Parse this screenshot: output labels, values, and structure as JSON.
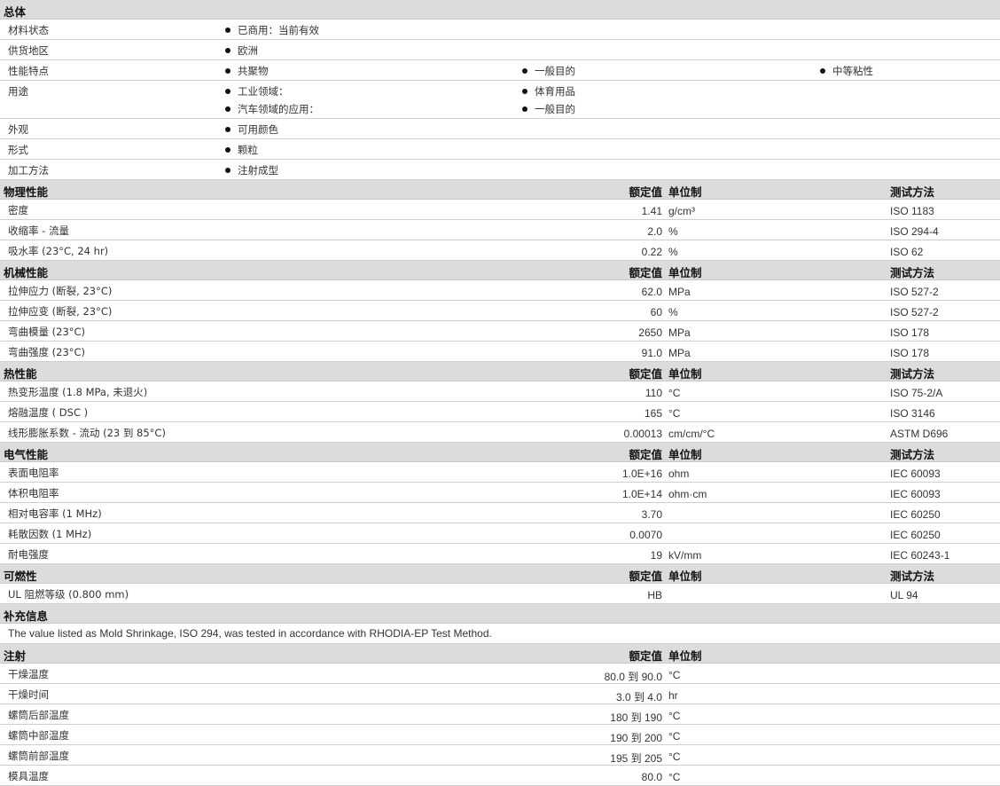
{
  "sections": {
    "general": {
      "title": "总体",
      "rows": [
        {
          "label": "材料状态",
          "items": [
            "已商用：当前有效"
          ]
        },
        {
          "label": "供货地区",
          "items": [
            "欧洲"
          ]
        },
        {
          "label": "性能特点",
          "items": [
            "共聚物",
            "一般目的",
            "中等粘性"
          ]
        },
        {
          "label": "用途",
          "items": [
            "工业领域：",
            "体育用品",
            "汽车领域的应用：",
            "一般目的"
          ]
        },
        {
          "label": "外观",
          "items": [
            "可用颜色"
          ]
        },
        {
          "label": "形式",
          "items": [
            "颗粒"
          ]
        },
        {
          "label": "加工方法",
          "items": [
            "注射成型"
          ]
        }
      ]
    },
    "col_heads": {
      "nominal": "额定值",
      "unit": "单位制",
      "test": "测试方法"
    },
    "physical": {
      "title": "物理性能",
      "rows": [
        {
          "label": "密度",
          "nominal": "1.41",
          "unit": "g/cm³",
          "test": "ISO 1183"
        },
        {
          "label": "收缩率 - 流量",
          "nominal": "2.0",
          "unit": "%",
          "test": "ISO 294-4"
        },
        {
          "label": "吸水率 (23°C, 24 hr)",
          "nominal": "0.22",
          "unit": "%",
          "test": "ISO 62"
        }
      ]
    },
    "mechanical": {
      "title": "机械性能",
      "rows": [
        {
          "label": "拉伸应力 (断裂, 23°C)",
          "nominal": "62.0",
          "unit": "MPa",
          "test": "ISO 527-2"
        },
        {
          "label": "拉伸应变 (断裂, 23°C)",
          "nominal": "60",
          "unit": "%",
          "test": "ISO 527-2"
        },
        {
          "label": "弯曲模量 (23°C)",
          "nominal": "2650",
          "unit": "MPa",
          "test": "ISO 178"
        },
        {
          "label": "弯曲强度 (23°C)",
          "nominal": "91.0",
          "unit": "MPa",
          "test": "ISO 178"
        }
      ]
    },
    "thermal": {
      "title": "热性能",
      "rows": [
        {
          "label": "热变形温度 (1.8 MPa, 未退火)",
          "nominal": "110",
          "unit": "°C",
          "test": "ISO 75-2/A"
        },
        {
          "label": "熔融温度 ( DSC )",
          "nominal": "165",
          "unit": "°C",
          "test": "ISO 3146"
        },
        {
          "label": "线形膨胀系数 - 流动 (23 到 85°C)",
          "nominal": "0.00013",
          "unit": "cm/cm/°C",
          "test": "ASTM D696"
        }
      ]
    },
    "electrical": {
      "title": "电气性能",
      "rows": [
        {
          "label": "表面电阻率",
          "nominal": "1.0E+16",
          "unit": "ohm",
          "test": "IEC 60093"
        },
        {
          "label": "体积电阻率",
          "nominal": "1.0E+14",
          "unit": "ohm·cm",
          "test": "IEC 60093"
        },
        {
          "label": "相对电容率 (1 MHz)",
          "nominal": "3.70",
          "unit": "",
          "test": "IEC 60250"
        },
        {
          "label": "耗散因数 (1 MHz)",
          "nominal": "0.0070",
          "unit": "",
          "test": "IEC 60250"
        },
        {
          "label": "耐电强度",
          "nominal": "19",
          "unit": "kV/mm",
          "test": "IEC 60243-1"
        }
      ]
    },
    "flammability": {
      "title": "可燃性",
      "rows": [
        {
          "label": "UL 阻燃等级 (0.800 mm)",
          "nominal": "HB",
          "unit": "",
          "test": "UL 94"
        }
      ]
    },
    "supplement": {
      "title": "补充信息",
      "note": "The value listed as Mold Shrinkage, ISO 294, was tested in accordance with RHODIA-EP Test Method."
    },
    "injection": {
      "title": "注射",
      "rows": [
        {
          "label": "干燥温度",
          "nominal": "80.0 到  90.0",
          "unit": "°C"
        },
        {
          "label": "干燥时间",
          "nominal": "3.0 到  4.0",
          "unit": "hr"
        },
        {
          "label": "螺筒后部温度",
          "nominal": "180 到  190",
          "unit": "°C"
        },
        {
          "label": "螺筒中部温度",
          "nominal": "190 到  200",
          "unit": "°C"
        },
        {
          "label": "螺筒前部温度",
          "nominal": "195 到  205",
          "unit": "°C"
        },
        {
          "label": "模具温度",
          "nominal": "80.0",
          "unit": "°C"
        }
      ]
    }
  }
}
